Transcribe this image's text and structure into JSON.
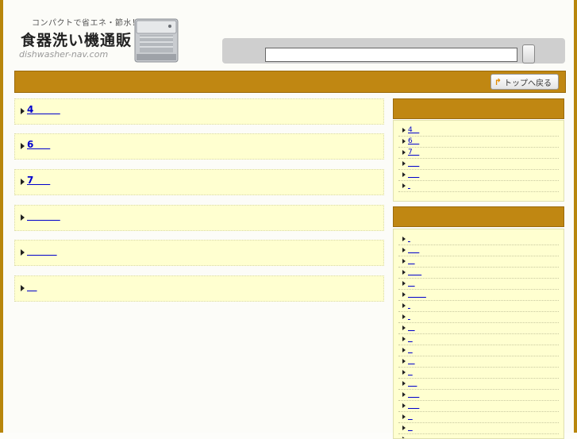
{
  "header": {
    "tagline": "コンパクトで省エネ・節水！",
    "site_title": "食器洗い機通販",
    "domain": "dishwasher-nav.com",
    "search_placeholder": "",
    "search_value": ""
  },
  "nav": {
    "top_button_label": "トップへ戻る"
  },
  "main": {
    "items": [
      {
        "label": "4        "
      },
      {
        "label": "6     "
      },
      {
        "label": "7     "
      },
      {
        "label": "          "
      },
      {
        "label": "         "
      },
      {
        "label": "   "
      }
    ]
  },
  "sidebar": {
    "section1_header": "",
    "section1_items": [
      {
        "label": "4   "
      },
      {
        "label": "6   "
      },
      {
        "label": "7   "
      },
      {
        "label": "     "
      },
      {
        "label": "     "
      },
      {
        "label": " "
      }
    ],
    "section2_header": "",
    "section2_items": [
      {
        "label": " "
      },
      {
        "label": "     "
      },
      {
        "label": "   "
      },
      {
        "label": "      "
      },
      {
        "label": "   "
      },
      {
        "label": "        "
      },
      {
        "label": " "
      },
      {
        "label": " "
      },
      {
        "label": "   "
      },
      {
        "label": "  "
      },
      {
        "label": "  "
      },
      {
        "label": "   "
      },
      {
        "label": "  "
      },
      {
        "label": "    "
      },
      {
        "label": "     "
      },
      {
        "label": "     "
      },
      {
        "label": "  "
      },
      {
        "label": "  "
      },
      {
        "label": "    "
      },
      {
        "label": " "
      }
    ]
  },
  "colors": {
    "accent": "#c08712",
    "panel": "#ffffd0",
    "link": "#0000cc"
  }
}
